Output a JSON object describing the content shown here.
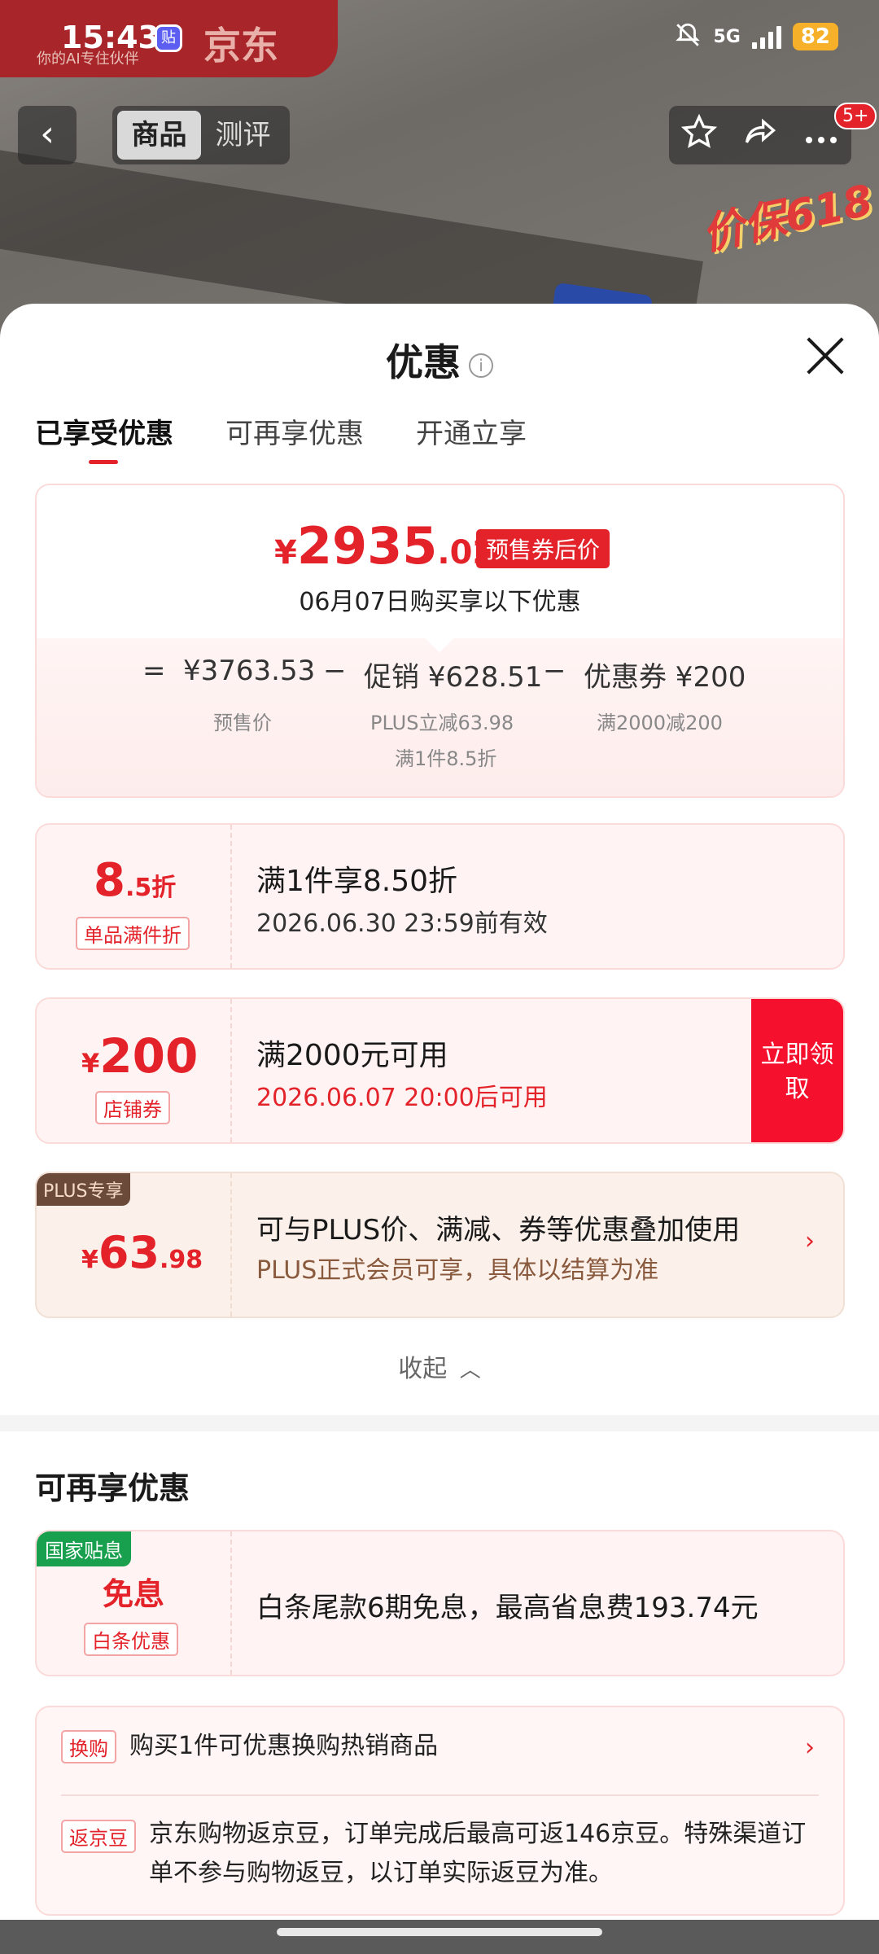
{
  "status_bar": {
    "time": "15:43",
    "app_icon_glyph": "贴",
    "network": "5G",
    "battery": "82"
  },
  "background": {
    "banner_brand": "京东",
    "banner_sub": "你的AI专住伙伴",
    "promo_badge": "价保618"
  },
  "top_nav": {
    "tabs": [
      "商品",
      "测评"
    ],
    "active_tab": 0,
    "notification_badge": "5+"
  },
  "sheet": {
    "title": "优惠",
    "tabs": [
      "已享受优惠",
      "可再享优惠",
      "开通立享"
    ],
    "active_tab": 0
  },
  "summary": {
    "currency": "¥",
    "price_int": "2935",
    "price_dec": ".02",
    "price_tag": "预售券后价",
    "buy_date_note": "06月07日购买享以下优惠",
    "formula": {
      "eq": "=",
      "presale_price": "¥3763.53",
      "minus1": "−",
      "promo_label": "促销 ¥628.51",
      "minus2": "−",
      "coupon_label": "优惠券 ¥200",
      "presale_sub": "预售价",
      "promo_sub1": "PLUS立减63.98",
      "promo_sub2": "满1件8.5折",
      "coupon_sub": "满2000减200"
    }
  },
  "coupons": [
    {
      "value_int": "8",
      "value_dec": ".5折",
      "chip": "单品满件折",
      "title": "满1件享8.50折",
      "subtitle": "2026.06.30 23:59前有效"
    },
    {
      "currency": "¥",
      "value_int": "200",
      "chip": "店铺券",
      "title": "满2000元可用",
      "subtitle": "2026.06.07 20:00后可用",
      "button": "立即领取"
    },
    {
      "tag": "PLUS专享",
      "currency": "¥",
      "value_int": "63",
      "value_dec": ".98",
      "title": "可与PLUS价、满减、券等优惠叠加使用",
      "subtitle": "PLUS正式会员可享，具体以结算为准"
    }
  ],
  "collapse_label": "收起",
  "more_section": {
    "title": "可再享优惠",
    "baitiao": {
      "tag": "国家贴息",
      "value": "免息",
      "chip": "白条优惠",
      "title": "白条尾款6期免息，最高省息费193.74元"
    },
    "items": [
      {
        "chip": "换购",
        "text": "购买1件可优惠换购热销商品"
      },
      {
        "chip": "返京豆",
        "text": "京东购物返京豆，订单完成后最高可返146京豆。特殊渠道订单不参与购物返豆，以订单实际返豆为准。"
      }
    ]
  },
  "colors": {
    "accent_red": "#e3222a",
    "plus_brown": "#6c4a3a",
    "gov_green": "#19a04e"
  }
}
